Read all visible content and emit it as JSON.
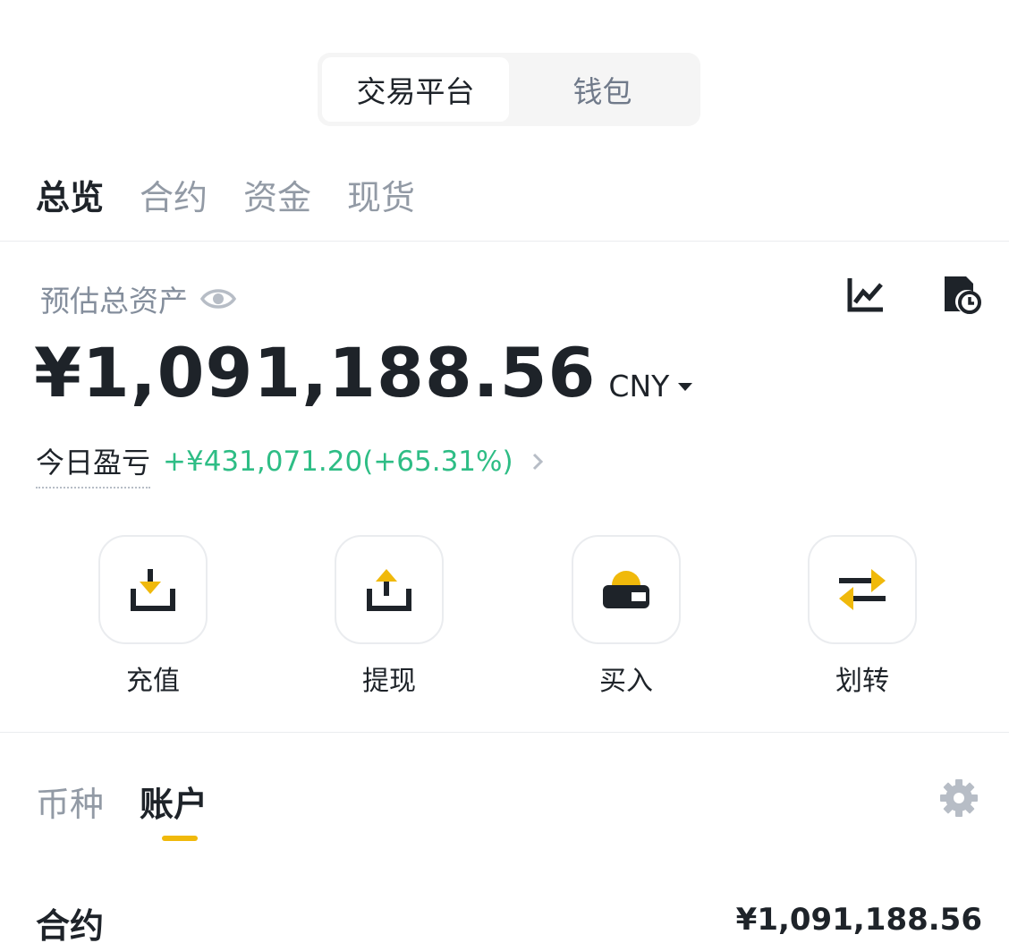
{
  "segment": {
    "options": [
      "交易平台",
      "钱包"
    ],
    "active_index": 0
  },
  "top_tabs": [
    "总览",
    "合约",
    "资金",
    "现货"
  ],
  "overview": {
    "estimated_label": "预估总资产",
    "balance": "¥1,091,188.56",
    "currency": "CNY",
    "pnl_label": "今日盈亏",
    "pnl_value": "+¥431,071.20(+65.31%)"
  },
  "actions": [
    {
      "label": "充值",
      "icon": "deposit-icon"
    },
    {
      "label": "提现",
      "icon": "withdraw-icon"
    },
    {
      "label": "买入",
      "icon": "buy-icon"
    },
    {
      "label": "划转",
      "icon": "transfer-icon"
    }
  ],
  "bottom_tabs": [
    "币种",
    "账户"
  ],
  "bottom_tabs_active_index": 1,
  "accounts": [
    {
      "name": "合约",
      "value": "¥1,091,188.56"
    }
  ],
  "colors": {
    "accent": "#f0b90b",
    "positive": "#2ebd85",
    "text": "#1e2329",
    "muted": "#929aa5"
  }
}
